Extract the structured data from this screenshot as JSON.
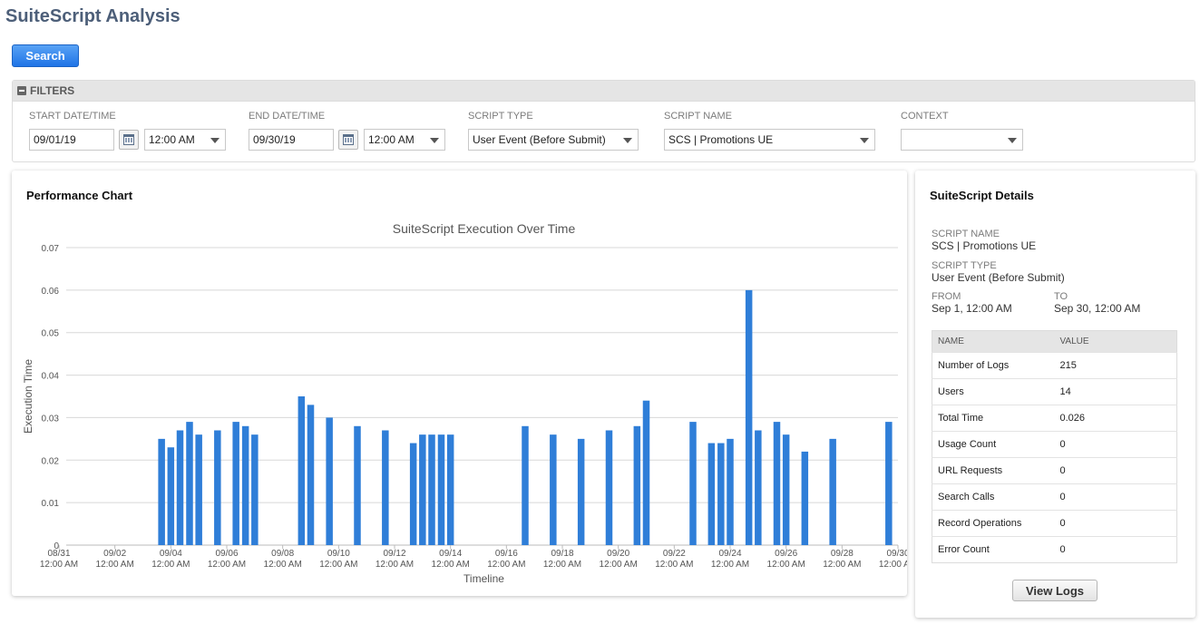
{
  "page": {
    "title": "SuiteScript Analysis"
  },
  "toolbar": {
    "search_label": "Search"
  },
  "filters": {
    "header": "FILTERS",
    "start": {
      "label": "START DATE/TIME",
      "date": "09/01/19",
      "time": "12:00 AM"
    },
    "end": {
      "label": "END DATE/TIME",
      "date": "09/30/19",
      "time": "12:00 AM"
    },
    "script_type": {
      "label": "SCRIPT TYPE",
      "value": "User Event (Before Submit)"
    },
    "script_name": {
      "label": "SCRIPT NAME",
      "value": "SCS | Promotions UE"
    },
    "context": {
      "label": "CONTEXT",
      "value": ""
    }
  },
  "performance": {
    "title": "Performance Chart"
  },
  "chart_data": {
    "type": "bar",
    "title": "SuiteScript Execution Over Time",
    "xlabel": "Timeline",
    "ylabel": "Execution Time",
    "ylim": [
      0,
      0.07
    ],
    "yticks": [
      "0",
      "0.01",
      "0.02",
      "0.03",
      "0.04",
      "0.05",
      "0.06",
      "0.07"
    ],
    "xlim_days": [
      0,
      30
    ],
    "xticks": [
      {
        "day": 0,
        "date": "08/31",
        "time": "12:00 AM"
      },
      {
        "day": 2,
        "date": "09/02",
        "time": "12:00 AM"
      },
      {
        "day": 4,
        "date": "09/04",
        "time": "12:00 AM"
      },
      {
        "day": 6,
        "date": "09/06",
        "time": "12:00 AM"
      },
      {
        "day": 8,
        "date": "09/08",
        "time": "12:00 AM"
      },
      {
        "day": 10,
        "date": "09/10",
        "time": "12:00 AM"
      },
      {
        "day": 12,
        "date": "09/12",
        "time": "12:00 AM"
      },
      {
        "day": 14,
        "date": "09/14",
        "time": "12:00 AM"
      },
      {
        "day": 16,
        "date": "09/16",
        "time": "12:00 AM"
      },
      {
        "day": 18,
        "date": "09/18",
        "time": "12:00 AM"
      },
      {
        "day": 20,
        "date": "09/20",
        "time": "12:00 AM"
      },
      {
        "day": 22,
        "date": "09/22",
        "time": "12:00 AM"
      },
      {
        "day": 24,
        "date": "09/24",
        "time": "12:00 AM"
      },
      {
        "day": 26,
        "date": "09/26",
        "time": "12:00 AM"
      },
      {
        "day": 28,
        "date": "09/28",
        "time": "12:00 AM"
      },
      {
        "day": 30,
        "date": "09/30",
        "time": "12:00 AM"
      }
    ],
    "points": [
      {
        "x": 3.67,
        "y": 0.025
      },
      {
        "x": 4.0,
        "y": 0.023
      },
      {
        "x": 4.33,
        "y": 0.027
      },
      {
        "x": 4.67,
        "y": 0.029
      },
      {
        "x": 5.0,
        "y": 0.026
      },
      {
        "x": 5.67,
        "y": 0.027
      },
      {
        "x": 6.33,
        "y": 0.029
      },
      {
        "x": 6.67,
        "y": 0.028
      },
      {
        "x": 7.0,
        "y": 0.026
      },
      {
        "x": 8.67,
        "y": 0.035
      },
      {
        "x": 9.0,
        "y": 0.033
      },
      {
        "x": 9.67,
        "y": 0.03
      },
      {
        "x": 10.67,
        "y": 0.028
      },
      {
        "x": 11.67,
        "y": 0.027
      },
      {
        "x": 12.67,
        "y": 0.024
      },
      {
        "x": 13.0,
        "y": 0.026
      },
      {
        "x": 13.33,
        "y": 0.026
      },
      {
        "x": 13.67,
        "y": 0.026
      },
      {
        "x": 14.0,
        "y": 0.026
      },
      {
        "x": 16.67,
        "y": 0.028
      },
      {
        "x": 17.67,
        "y": 0.026
      },
      {
        "x": 18.67,
        "y": 0.025
      },
      {
        "x": 19.67,
        "y": 0.027
      },
      {
        "x": 20.67,
        "y": 0.028
      },
      {
        "x": 21.0,
        "y": 0.034
      },
      {
        "x": 22.67,
        "y": 0.029
      },
      {
        "x": 23.33,
        "y": 0.024
      },
      {
        "x": 23.67,
        "y": 0.024
      },
      {
        "x": 24.0,
        "y": 0.025
      },
      {
        "x": 24.67,
        "y": 0.06
      },
      {
        "x": 25.0,
        "y": 0.027
      },
      {
        "x": 25.67,
        "y": 0.029
      },
      {
        "x": 26.0,
        "y": 0.026
      },
      {
        "x": 26.67,
        "y": 0.022
      },
      {
        "x": 27.67,
        "y": 0.025
      },
      {
        "x": 29.67,
        "y": 0.029
      }
    ],
    "bar_color": "#2f7ed8",
    "grid": true
  },
  "details": {
    "title": "SuiteScript Details",
    "script_name_label": "SCRIPT NAME",
    "script_name": "SCS | Promotions UE",
    "script_type_label": "SCRIPT TYPE",
    "script_type": "User Event (Before Submit)",
    "from_label": "FROM",
    "from": "Sep 1, 12:00 AM",
    "to_label": "TO",
    "to": "Sep 30, 12:00 AM",
    "table": {
      "headers": [
        "NAME",
        "VALUE"
      ],
      "rows": [
        [
          "Number of Logs",
          "215"
        ],
        [
          "Users",
          "14"
        ],
        [
          "Total Time",
          "0.026"
        ],
        [
          "Usage Count",
          "0"
        ],
        [
          "URL Requests",
          "0"
        ],
        [
          "Search Calls",
          "0"
        ],
        [
          "Record Operations",
          "0"
        ],
        [
          "Error Count",
          "0"
        ]
      ]
    },
    "view_logs_label": "View Logs"
  }
}
